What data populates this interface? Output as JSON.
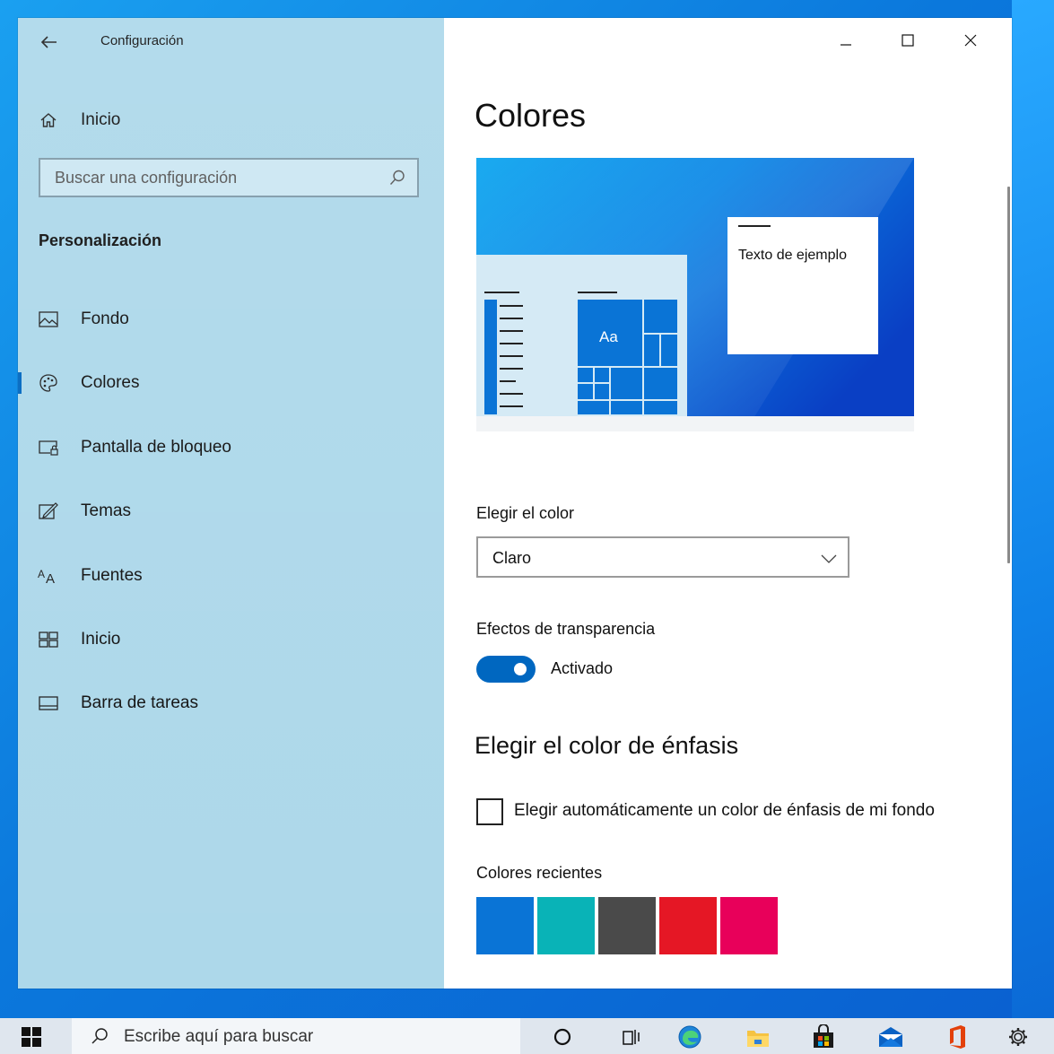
{
  "window": {
    "app_title": "Configuración",
    "controls": [
      "minimize",
      "maximize",
      "close"
    ]
  },
  "sidebar": {
    "home_label": "Inicio",
    "search_placeholder": "Buscar una configuración",
    "section_title": "Personalización",
    "items": [
      {
        "label": "Fondo",
        "icon": "picture-icon"
      },
      {
        "label": "Colores",
        "icon": "palette-icon",
        "active": true
      },
      {
        "label": "Pantalla de bloqueo",
        "icon": "lock-screen-icon"
      },
      {
        "label": "Temas",
        "icon": "themes-icon"
      },
      {
        "label": "Fuentes",
        "icon": "fonts-icon"
      },
      {
        "label": "Inicio",
        "icon": "start-icon"
      },
      {
        "label": "Barra de tareas",
        "icon": "taskbar-icon"
      }
    ]
  },
  "main": {
    "title": "Colores",
    "preview": {
      "sample_text": "Texto de ejemplo",
      "tile_label": "Aa"
    },
    "choose_color_label": "Elegir el color",
    "choose_color_value": "Claro",
    "transparency_label": "Efectos de transparencia",
    "transparency_state": "Activado",
    "accent_heading": "Elegir el color de énfasis",
    "auto_accent_label": "Elegir automáticamente un color de énfasis de mi fondo",
    "recent_colors_label": "Colores recientes",
    "recent_colors": [
      "#0a74d6",
      "#09b3b7",
      "#4a4a4a",
      "#e51725",
      "#e8005a"
    ]
  },
  "colors": {
    "accent": "#0067c0",
    "sidebar_bg": "#add8ea"
  },
  "taskbar": {
    "search_placeholder": "Escribe aquí para buscar",
    "icons": [
      "windows-start-icon",
      "search-icon",
      "cortana-icon",
      "task-view-icon",
      "edge-icon",
      "file-explorer-icon",
      "store-icon",
      "mail-icon",
      "office-icon",
      "settings-gear-icon"
    ]
  }
}
